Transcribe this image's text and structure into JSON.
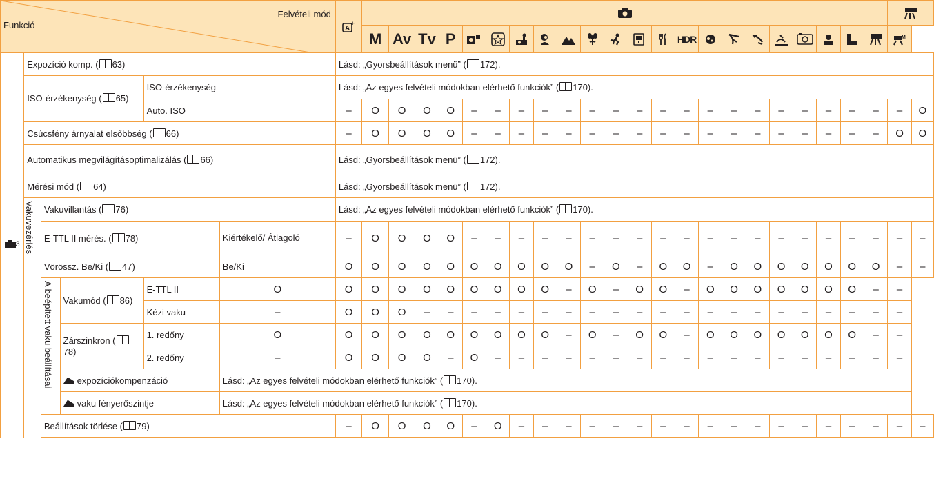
{
  "header": {
    "funkcio": "Funkció",
    "felveteli_mod": "Felvételi mód",
    "modes": [
      "M",
      "Av",
      "Tv",
      "P"
    ],
    "icon_names": [
      "auto-plus-icon",
      "camera-icon",
      "movie-icon",
      "creative-mode-icon",
      "star-mode-icon",
      "kids-mode-icon",
      "portrait-icon",
      "landscape-icon",
      "closeup-icon",
      "sports-icon",
      "handheld-night-icon",
      "food-icon",
      "hdr-icon",
      "soft-focus-icon",
      "bw-icon",
      "toy-camera-icon",
      "fisheye-icon",
      "miniature-icon",
      "monochrome-icon",
      "movie-auto-icon",
      "movie-m-icon"
    ],
    "hdr_label": "HDR"
  },
  "rows": {
    "section": "3",
    "expo_comp": "Expozíció komp. (",
    "expo_comp_page": "63)",
    "iso_group": "ISO-érzékenység (",
    "iso_group_page": "65)",
    "iso_sub": "ISO-érzékenység",
    "auto_iso": "Auto. ISO",
    "csucs": "Csúcsfény árnyalat elsőbbség (",
    "csucs_page": "66)",
    "auto_megv": "Automatikus megvilágításoptimalizálás (",
    "auto_megv_page": "66)",
    "meresi": "Mérési mód (",
    "meresi_page": "64)",
    "vakuvezerles": "Vakuvezérlés",
    "vakuvillantas": "Vakuvillantás (",
    "vakuvillantas_page": "76)",
    "ettl_meres": "E-TTL II mérés. (",
    "ettl_meres_page": "78)",
    "kiertekelo": "Kiértékelő/ Átlagoló",
    "voross": "Vörössz. Be/Ki (",
    "voross_page": "47)",
    "beki": "Be/Ki",
    "beepitett": "A beépített vaku beállításai",
    "vakumod": "Vakumód (",
    "vakumod_page": "86)",
    "ettl2": "E-TTL II",
    "kezi_vaku": "Kézi vaku",
    "zarszinkron": "Zárszinkron (",
    "zarszinkron_page": "78)",
    "redony1": "1. redőny",
    "redony2": "2. redőny",
    "expo_komp_vaku": "expozíciókompenzáció",
    "vaku_feny": "vaku fényerőszintje",
    "torles": "Beállítások törlése (",
    "torles_page": "79)"
  },
  "see": {
    "gyors": "Lásd: „Gyorsbeállítások menü” (",
    "gyors_page": "172).",
    "egyes": "Lásd: „Az egyes felvételi módokban elérhető funkciók” (",
    "egyes_page": "170)."
  },
  "symbols": {
    "auto_iso": [
      "–",
      "O",
      "O",
      "O",
      "O",
      "–",
      "–",
      "–",
      "–",
      "–",
      "–",
      "–",
      "–",
      "–",
      "–",
      "–",
      "–",
      "–",
      "–",
      "–",
      "–",
      "–",
      "–",
      "–",
      "O"
    ],
    "csucs": [
      "–",
      "O",
      "O",
      "O",
      "O",
      "–",
      "–",
      "–",
      "–",
      "–",
      "–",
      "–",
      "–",
      "–",
      "–",
      "–",
      "–",
      "–",
      "–",
      "–",
      "–",
      "–",
      "–",
      "O",
      "O"
    ],
    "ettl_meres": [
      "–",
      "O",
      "O",
      "O",
      "O",
      "–",
      "–",
      "–",
      "–",
      "–",
      "–",
      "–",
      "–",
      "–",
      "–",
      "–",
      "–",
      "–",
      "–",
      "–",
      "–",
      "–",
      "–",
      "–",
      "–"
    ],
    "voross": [
      "O",
      "O",
      "O",
      "O",
      "O",
      "O",
      "O",
      "O",
      "O",
      "O",
      "–",
      "O",
      "–",
      "O",
      "O",
      "–",
      "O",
      "O",
      "O",
      "O",
      "O",
      "O",
      "O",
      "–",
      "–"
    ],
    "ettl2": [
      "O",
      "O",
      "O",
      "O",
      "O",
      "O",
      "O",
      "O",
      "O",
      "O",
      "–",
      "O",
      "–",
      "O",
      "O",
      "–",
      "O",
      "O",
      "O",
      "O",
      "O",
      "O",
      "O",
      "–",
      "–"
    ],
    "kezi": [
      "–",
      "O",
      "O",
      "O",
      "–",
      "–",
      "–",
      "–",
      "–",
      "–",
      "–",
      "–",
      "–",
      "–",
      "–",
      "–",
      "–",
      "–",
      "–",
      "–",
      "–",
      "–",
      "–",
      "–",
      "–"
    ],
    "redony1": [
      "O",
      "O",
      "O",
      "O",
      "O",
      "O",
      "O",
      "O",
      "O",
      "O",
      "–",
      "O",
      "–",
      "O",
      "O",
      "–",
      "O",
      "O",
      "O",
      "O",
      "O",
      "O",
      "O",
      "–",
      "–"
    ],
    "redony2": [
      "–",
      "O",
      "O",
      "O",
      "O",
      "–",
      "O",
      "–",
      "–",
      "–",
      "–",
      "–",
      "–",
      "–",
      "–",
      "–",
      "–",
      "–",
      "–",
      "–",
      "–",
      "–",
      "–",
      "–",
      "–"
    ],
    "torles": [
      "–",
      "O",
      "O",
      "O",
      "O",
      "–",
      "O",
      "–",
      "–",
      "–",
      "–",
      "–",
      "–",
      "–",
      "–",
      "–",
      "–",
      "–",
      "–",
      "–",
      "–",
      "–",
      "–",
      "–",
      "–"
    ]
  },
  "colors": {
    "header_bg": "#fde4b8",
    "border": "#f2a041",
    "text": "#231f20"
  }
}
